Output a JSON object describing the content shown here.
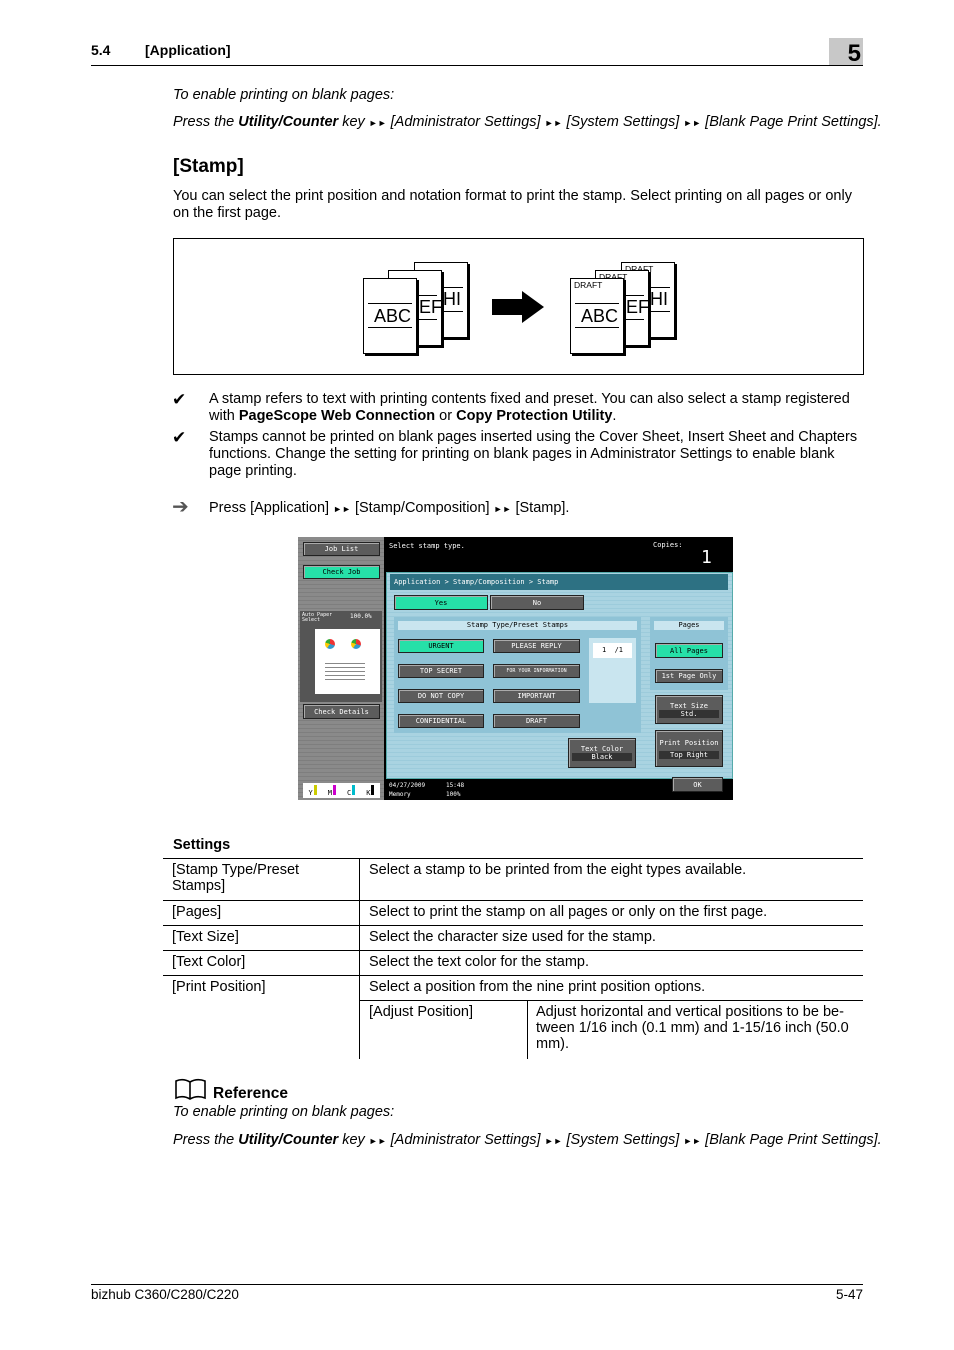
{
  "header": {
    "section": "5.4",
    "title": "[Application]",
    "chapter": "5"
  },
  "intro": {
    "line1": "To enable printing on blank pages:",
    "press_prefix": "Press the ",
    "key": "Utility/Counter",
    "key_suffix": " key ",
    "path": [
      "[Administrator Settings]",
      "[System Settings]",
      "[Blank Page Print Settings]."
    ],
    "arrow": "►►"
  },
  "stamp": {
    "heading": "[Stamp]",
    "description": "You can select the print position and notation format to print the stamp. Select printing on all pages or only on the first page."
  },
  "illustration": {
    "before_pages": [
      "ABC",
      "EF",
      "HI"
    ],
    "after_pages": [
      "ABC",
      "EF",
      "HI"
    ],
    "stamp_text": "DRAFT"
  },
  "notes": [
    {
      "icon": "check-icon",
      "pre": "A stamp refers to text with printing contents fixed and preset. You can also select a stamp registered with ",
      "b1": "PageScope Web Connection",
      "mid": " or ",
      "b2": "Copy Protection Utility",
      "post": "."
    },
    {
      "icon": "check-icon",
      "text": "Stamps cannot be printed on blank pages inserted using the Cover Sheet, Insert Sheet and Chapters functions. Change the setting for printing on blank pages in Administrator Settings to enable blank page printing."
    }
  ],
  "step": {
    "icon": "arrow-right-icon",
    "parts": [
      "Press [Application]",
      "[Stamp/Composition]",
      "[Stamp]."
    ]
  },
  "screen": {
    "job_list": "Job List",
    "check_job": "Check Job",
    "paper_label": "Auto Paper Select",
    "zoom": "100.0%",
    "check_details": "Check Details",
    "toners": [
      "Y",
      "M",
      "C",
      "K"
    ],
    "message": "Select stamp type.",
    "copies_label": "Copies:",
    "copies": "1",
    "breadcrumb": "Application > Stamp/Composition > Stamp",
    "yes": "Yes",
    "no": "No",
    "stamp_group": "Stamp Type/Preset Stamps",
    "stamps": [
      "URGENT",
      "PLEASE REPLY",
      "TOP SECRET",
      "FOR YOUR INFORMATION",
      "DO NOT COPY",
      "IMPORTANT",
      "CONFIDENTIAL",
      "DRAFT"
    ],
    "page_counter": "1  /1",
    "pages_group": "Pages",
    "all_pages": "All Pages",
    "first_page": "1st Page Only",
    "text_size_label": "Text Size",
    "text_size": "Std.",
    "print_position_label": "Print Position",
    "print_position": "Top Right",
    "text_color_label": "Text Color",
    "text_color": "Black",
    "date": "04/27/2009",
    "time": "15:48",
    "memory_label": "Memory",
    "memory": "100%",
    "ok": "OK"
  },
  "settings": {
    "title": "Settings",
    "rows": [
      {
        "name": "[Stamp Type/Preset Stamps]",
        "desc": "Select a stamp to be printed from the eight types available."
      },
      {
        "name": "[Pages]",
        "desc": "Select to print the stamp on all pages or only on the first page."
      },
      {
        "name": "[Text Size]",
        "desc": "Select the character size used for the stamp."
      },
      {
        "name": "[Text Color]",
        "desc": "Select the text color for the stamp."
      },
      {
        "name": "[Print Position]",
        "desc": "Select a position from the nine print position options.",
        "sub_name": "[Adjust Position]",
        "sub_desc": "Adjust horizontal and vertical positions to be be-tween 1/16 inch (0.1 mm) and 1-15/16 inch (50.0 mm)."
      }
    ]
  },
  "reference": {
    "icon": "book-icon",
    "title": "Reference",
    "line1": "To enable printing on blank pages:"
  },
  "footer": {
    "model": "bizhub C360/C280/C220",
    "page": "5-47"
  }
}
